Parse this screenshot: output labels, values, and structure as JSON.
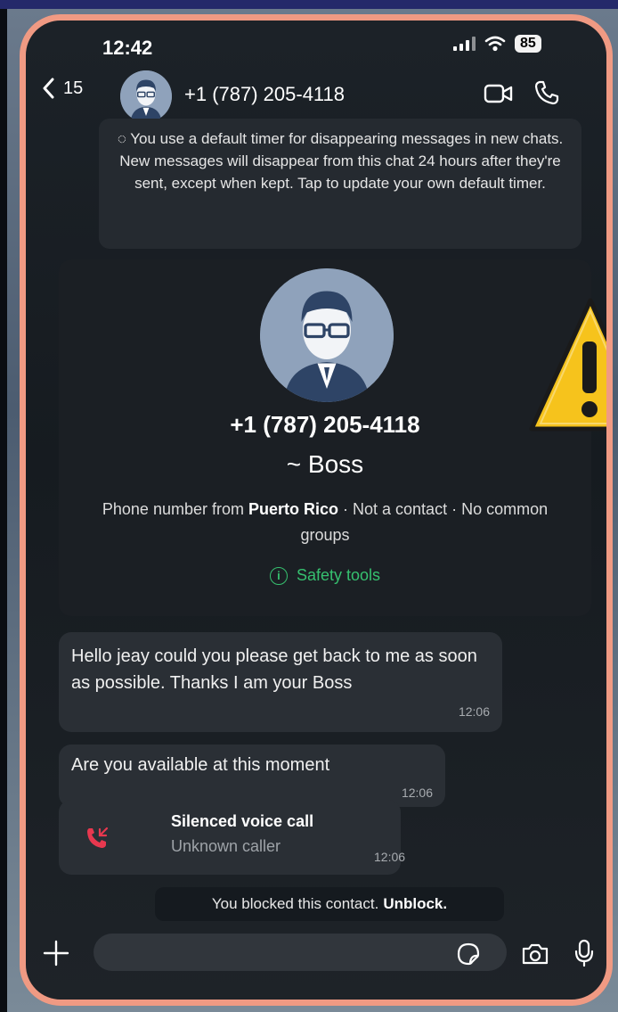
{
  "status": {
    "time": "12:42",
    "battery": "85"
  },
  "header": {
    "back_count": "15",
    "contact_name": "+1 (787) 205-4118"
  },
  "notice": {
    "text": "You use a default timer for disappearing messages in new chats. New messages will disappear from this chat 24 hours after they're sent, except when kept. Tap to update your own default timer."
  },
  "card": {
    "phone": "+1 (787) 205-4118",
    "alias": "~ Boss",
    "info_prefix": "Phone number from",
    "info_country": "Puerto Rico",
    "info_suffix": " · Not a contact · No common groups",
    "safety_label": "Safety tools"
  },
  "messages": [
    {
      "text": "Hello jeay could you please get back to me as soon as possible. Thanks I am your Boss",
      "time": "12:06"
    },
    {
      "text": "Are you available at this moment",
      "time": "12:06"
    }
  ],
  "call": {
    "title": "Silenced voice call",
    "subtitle": "Unknown caller",
    "time": "12:06"
  },
  "blocked": {
    "text": "You blocked this contact.",
    "action": "Unblock."
  },
  "colors": {
    "accent_green": "#36c06f",
    "frame": "#f09a83",
    "missed_call": "#e8384f",
    "warning": "#f6c31c"
  }
}
